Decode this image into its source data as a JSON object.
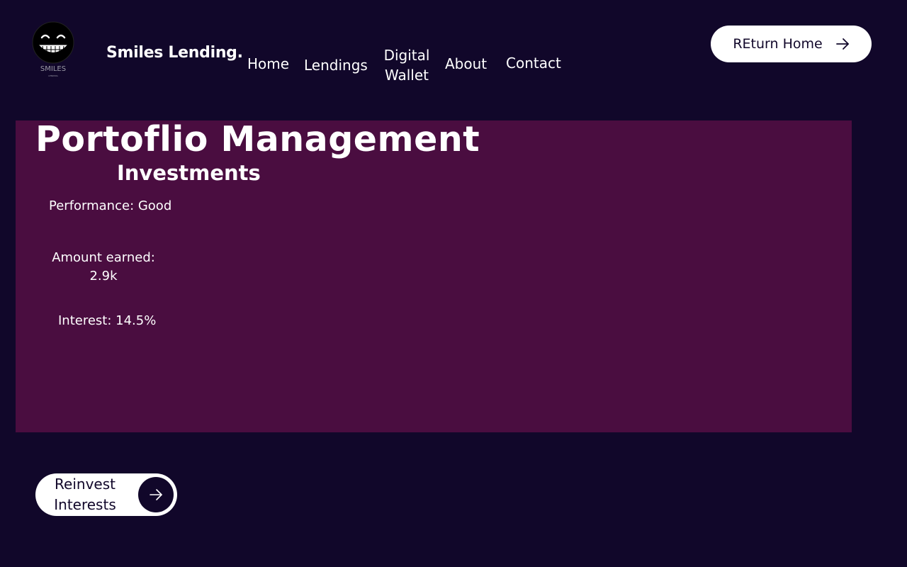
{
  "header": {
    "logo_text": "SMILES",
    "logo_subtext": "LENDING",
    "brand": "Smiles Lending.",
    "nav": {
      "home": "Home",
      "lendings": "Lendings",
      "wallet_line1": "Digital",
      "wallet_line2": "Wallet",
      "about": "About",
      "contact": "Contact"
    },
    "return_button": "REturn Home"
  },
  "main": {
    "title": "Portoflio Management",
    "section": "Investments",
    "performance": "Performance: Good",
    "amount_label": "Amount earned:",
    "amount_value": "2.9k",
    "interest": "Interest: 14.5%",
    "reinvest_line1": "Reinvest",
    "reinvest_line2": "Interests"
  },
  "colors": {
    "background": "#11072a",
    "panel": "#4a0d40",
    "button": "#ffffff"
  },
  "icons": {
    "logo": "smiley-face-icon",
    "return": "arrow-right-icon",
    "reinvest": "arrow-right-icon"
  }
}
